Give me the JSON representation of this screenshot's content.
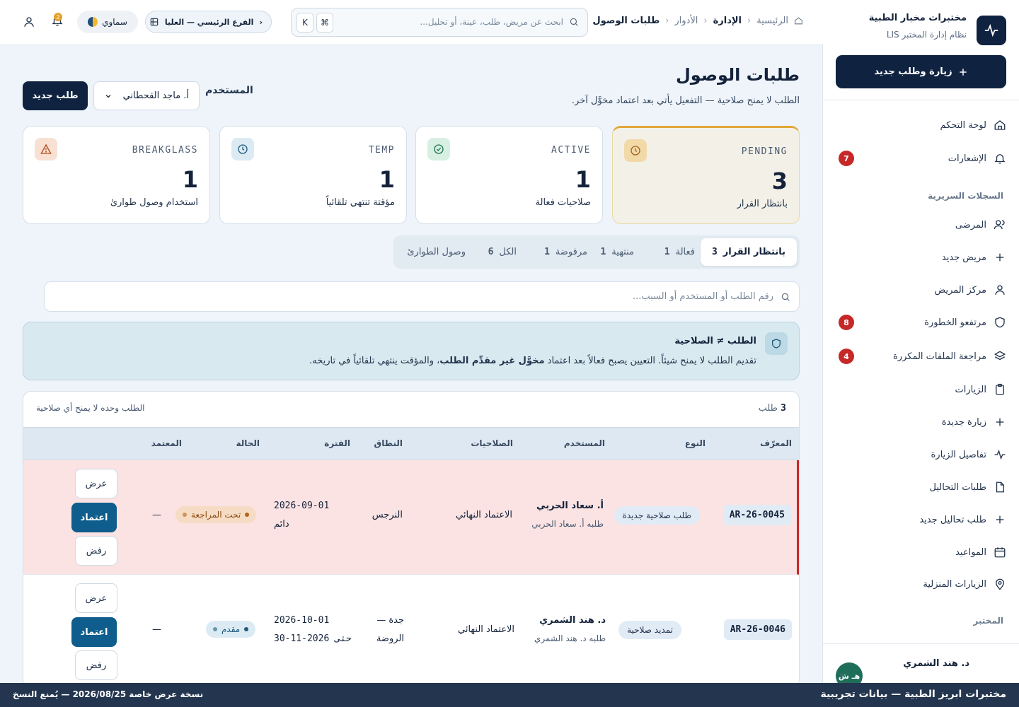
{
  "sidebar": {
    "brand_name": "مختبرات مخبار الطبية",
    "brand_sub": "نظام إدارة المختبر LIS",
    "new_visit_label": "زيارة وطلب جديد",
    "items": [
      {
        "label": "لوحة التحكم",
        "icon": "home-icon"
      },
      {
        "label": "الإشعارات",
        "icon": "bell-icon",
        "badge": "7"
      },
      {
        "label": "المرضى",
        "icon": "users-icon"
      },
      {
        "label": "مريض جديد",
        "icon": "plus-icon"
      },
      {
        "label": "مركز المريض",
        "icon": "user-icon"
      },
      {
        "label": "مرتفعو الخطورة",
        "icon": "shield-icon",
        "badge": "8"
      },
      {
        "label": "مراجعة الملفات المكررة",
        "icon": "layers-icon",
        "badge": "4"
      },
      {
        "label": "الزيارات",
        "icon": "clipboard-icon"
      },
      {
        "label": "زيارة جديدة",
        "icon": "plus-icon"
      },
      {
        "label": "تفاصيل الزيارة",
        "icon": "pulse-icon"
      },
      {
        "label": "طلبات التحاليل",
        "icon": "file-icon"
      },
      {
        "label": "طلب تحاليل جديد",
        "icon": "plus-icon"
      },
      {
        "label": "المواعيد",
        "icon": "calendar-icon"
      },
      {
        "label": "الزيارات المنزلية",
        "icon": "location-icon"
      }
    ],
    "section_clinical": "السجلات السريرية",
    "section_lab": "المختبر",
    "user_name": "د. هند الشمري",
    "user_initials": "هـ ش"
  },
  "topbar": {
    "crumbs": [
      "الرئيسية",
      "الإدارة",
      "الأدوار",
      "طلبات الوصول"
    ],
    "search_placeholder": "ابحث عن مريض، طلب، عينة، أو تحليل...",
    "kbd_cmd": "⌘",
    "kbd_k": "K",
    "branch": "الفرع الرئيسي — العليا",
    "theme_label": "سماوي",
    "bell_badge": "2"
  },
  "main": {
    "title": "طلبات الوصول",
    "subtitle": "الطلب لا يمنح صلاحية — التفعيل يأتي بعد اعتماد مخوَّل آخر.",
    "user_label": "المستخدم",
    "user_value": "أ. ماجد القحطاني",
    "new_request": "طلب جديد",
    "stats": [
      {
        "key": "PENDING",
        "value": "3",
        "desc": "بانتظار القرار"
      },
      {
        "key": "ACTIVE",
        "value": "1",
        "desc": "صلاحيات فعالة"
      },
      {
        "key": "TEMP",
        "value": "1",
        "desc": "مؤقتة تنتهي تلقائياً"
      },
      {
        "key": "BREAKGLASS",
        "value": "1",
        "desc": "استخدام وصول طوارئ"
      }
    ],
    "tabs": [
      {
        "label": "بانتظار القرار",
        "count": "3"
      },
      {
        "label": "فعالة",
        "count": "1"
      },
      {
        "label": "منتهية",
        "count": "1"
      },
      {
        "label": "مرفوضة",
        "count": "1"
      },
      {
        "label": "الكل",
        "count": "6"
      },
      {
        "label": "وصول الطوارئ",
        "count": ""
      }
    ],
    "filter_placeholder": "رقم الطلب أو المستخدم أو السبب...",
    "notice": {
      "title": "الطلب ≠ الصلاحية",
      "text_a": "تقديم الطلب لا يمنح شيئاً. التعيين يصبح فعالاً بعد اعتماد ",
      "text_b": "مخوَّل غير مقدِّم الطلب",
      "text_c": "، والمؤقت ينتهي تلقائياً في تاريخه."
    },
    "table": {
      "count_num": "3",
      "count_label": "طلب",
      "note": "الطلب وحده لا يمنح أي صلاحية",
      "headers": [
        "المعرّف",
        "النوع",
        "المستخدم",
        "الصلاحيات",
        "النطاق",
        "الفترة",
        "الحالة",
        "المعتمد"
      ],
      "rows": [
        {
          "id": "AR-26-0045",
          "type": "طلب صلاحية جديدة",
          "user": "أ. سعاد الحربي",
          "requested_by": "طلبه أ. سعاد الحربي",
          "permissions": "الاعتماد النهائي",
          "scope_a": "النرجس",
          "scope_b": "",
          "period_a": "2026-09-01",
          "period_b": "دائم",
          "status": "تحت المراجعة",
          "approver": "—",
          "actions": [
            "عرض",
            "اعتماد",
            "رفض"
          ]
        },
        {
          "id": "AR-26-0046",
          "type": "تمديد صلاحية",
          "user": "د. هند الشمري",
          "requested_by": "طلبه د. هند الشمري",
          "permissions": "الاعتماد النهائي",
          "scope_a": "جدة —",
          "scope_b": "الروضة",
          "period_a": "2026-10-01",
          "period_b": "حتى  2026-11-30",
          "status": "مقدم",
          "approver": "—",
          "actions": [
            "عرض",
            "اعتماد",
            "رفض"
          ]
        }
      ]
    }
  },
  "footer": {
    "right": "مختبرات ابريز الطبية — بيانات تجريبية",
    "left": "نسخة عرض خاصة 2026/08/25 — يُمنع النسخ"
  },
  "colors": {
    "navy": "#0f2341",
    "accent": "#0e5d8c",
    "danger": "#c62828",
    "warning": "#e2a73a"
  }
}
